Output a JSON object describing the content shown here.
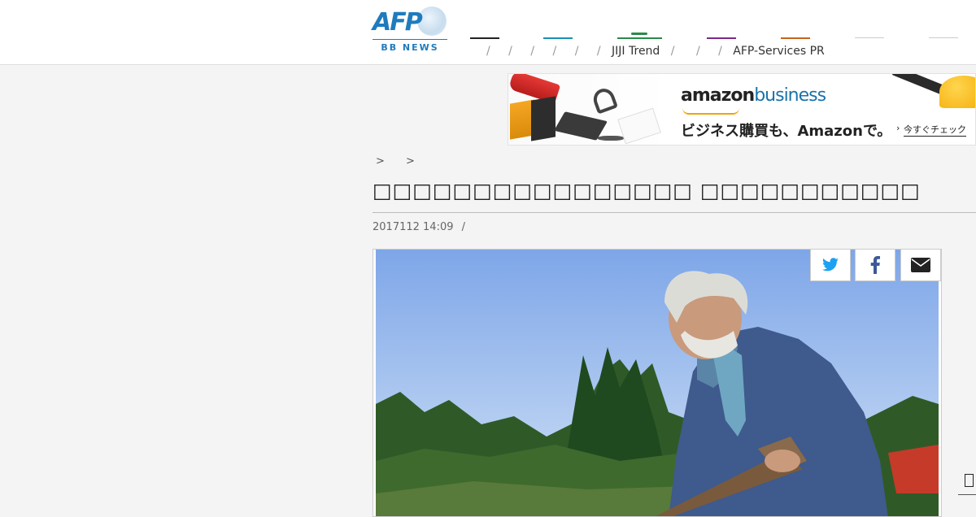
{
  "header": {
    "logo": {
      "brand": "AFP",
      "sub": "BB NEWS"
    },
    "nav": {
      "jiji_label": "JIJI Trend",
      "afp_services_label": "AFP-Services PR",
      "separator": "/",
      "bar_colors": [
        "#222222",
        "#1a8fb5",
        "#2a8a4a",
        "#7a2a8a",
        "#c8641a",
        "#cccccc",
        "#cccccc"
      ]
    }
  },
  "ad": {
    "brand_part1": "amazon",
    "brand_part2": "business",
    "tagline": "ビジネス購買も、Amazonで。",
    "cta": "今すぐチェック",
    "cta_arrow": "›"
  },
  "breadcrumb": {
    "sep1": ">",
    "sep2": ">"
  },
  "article": {
    "title": "□□□□□□□□□□□□□□□□ □□□□□□□□□□□",
    "date": "2017112 14:09",
    "date_sep": "/"
  },
  "share": {
    "twitter_icon": "twitter-icon",
    "facebook_icon": "facebook-icon",
    "email_icon": "envelope-icon"
  },
  "colors": {
    "brand_blue": "#1f7bbd",
    "twitter": "#1da1f2",
    "facebook": "#3b5998"
  }
}
